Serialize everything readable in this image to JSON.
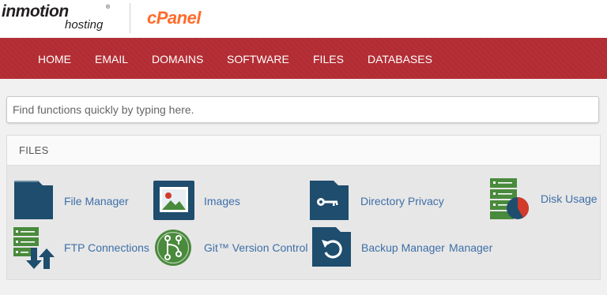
{
  "brand": {
    "host_name": "inmotion",
    "host_reg": "®",
    "host_sub": "hosting",
    "panel_name": "cPanel"
  },
  "nav": {
    "items": [
      "HOME",
      "EMAIL",
      "DOMAINS",
      "SOFTWARE",
      "FILES",
      "DATABASES"
    ]
  },
  "search": {
    "placeholder": "Find functions quickly by typing here."
  },
  "section": {
    "title": "FILES",
    "items": [
      {
        "label": "File Manager",
        "icon": "folder-icon"
      },
      {
        "label": "Images",
        "icon": "image-icon"
      },
      {
        "label": "Directory Privacy",
        "icon": "folder-key-icon"
      },
      {
        "label": "Disk Usage",
        "icon": "disk-usage-icon"
      },
      {
        "label": "FTP Connections",
        "icon": "ftp-connections-icon"
      },
      {
        "label": "Git™ Version Control",
        "icon": "git-icon"
      },
      {
        "label": "Backup Manager",
        "icon": "folder-backup-icon"
      },
      {
        "label": "Manager",
        "icon": ""
      }
    ]
  },
  "colors": {
    "nav_bg": "#b72f36",
    "accent_link": "#3d6fa8",
    "icon_navy": "#1e4d6e",
    "icon_green": "#4a8a3c",
    "icon_red": "#d23a2c"
  }
}
